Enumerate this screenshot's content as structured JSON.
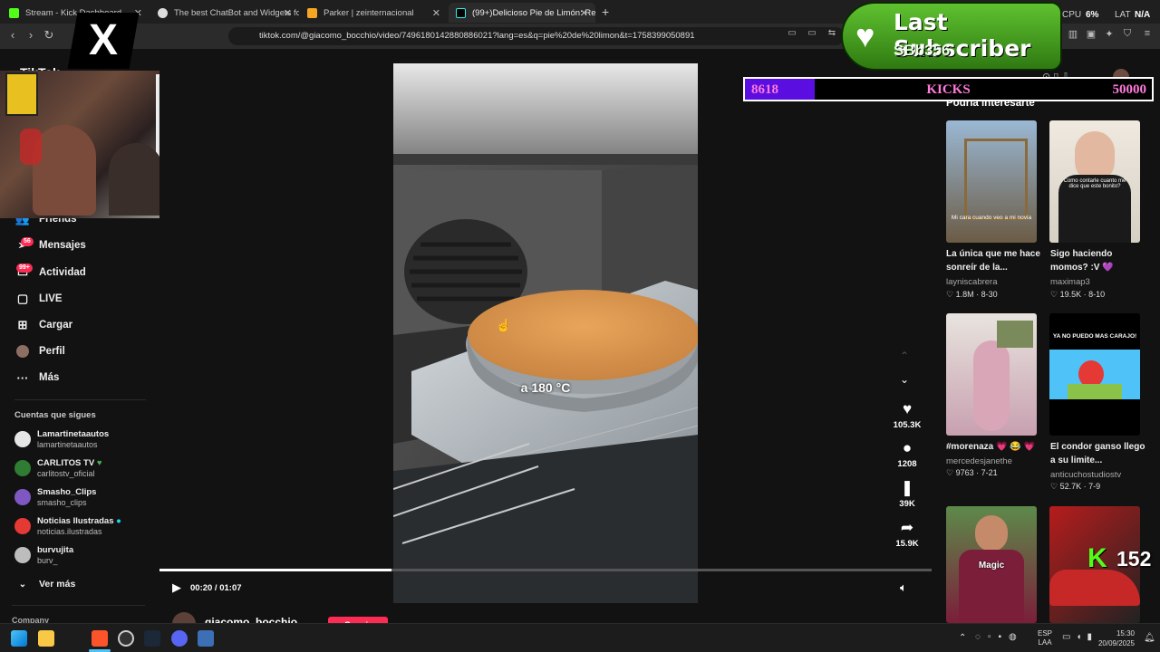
{
  "browser": {
    "tabs": [
      {
        "title": "Stream - Kick Dashboard",
        "active": false
      },
      {
        "title": "The best ChatBot and Widgets for Ki",
        "active": false
      },
      {
        "title": "Parker | zeinternacional",
        "active": false
      },
      {
        "title": "(99+)Delicioso Pie de Limón: Re",
        "active": true
      }
    ],
    "new_tab_label": "+",
    "url": "tiktok.com/@giacomo_bocchio/video/7496180142880886021?lang=es&q=pie%20de%20limon&t=1758399050891",
    "cpu_label": "CPU",
    "cpu_value": "6%",
    "lat_label": "LAT",
    "lat_value": "N/A"
  },
  "overlay": {
    "x_logo": "X",
    "subscriber_title": "Last Subscriber",
    "subscriber_name": "SBb356",
    "kicks_current": "8618",
    "kicks_label": "KICKS",
    "kicks_goal": "50000",
    "kicks_progress": 0.172,
    "kick_logo": "K",
    "kick_count": "152"
  },
  "sidebar": {
    "logo_partial": "TikTok",
    "nav": [
      {
        "label": "Friends",
        "icon": "friends-icon"
      },
      {
        "label": "Mensajes",
        "icon": "messages-icon",
        "badge": "56"
      },
      {
        "label": "Actividad",
        "icon": "activity-icon",
        "badge": "99+"
      },
      {
        "label": "LIVE",
        "icon": "live-icon"
      },
      {
        "label": "Cargar",
        "icon": "upload-icon"
      },
      {
        "label": "Perfil",
        "icon": "profile-icon"
      },
      {
        "label": "Más",
        "icon": "more-icon"
      }
    ],
    "following_heading": "Cuentas que sigues",
    "following": [
      {
        "name": "Lamartinetaautos",
        "handle": "lamartinetaautos",
        "color": "#e6e6e6"
      },
      {
        "name": "CARLITOS TV",
        "handle": "carlitostv_oficial",
        "color": "#2e7d32"
      },
      {
        "name": "Smasho_Clips",
        "handle": "smasho_clips",
        "color": "#7e57c2"
      },
      {
        "name": "Noticias Ilustradas",
        "handle": "noticias.ilustradas",
        "color": "#e53935"
      },
      {
        "name": "burvujita",
        "handle": "burv_",
        "color": "#bdbdbd"
      }
    ],
    "see_more": "Ver más",
    "company": "Company"
  },
  "video": {
    "caption_overlay": "a 180 °C",
    "time": "00:20 / 01:07",
    "progress": 0.3,
    "author": "giacomo_bocchio",
    "follow_label": "Seguir"
  },
  "actions": [
    {
      "icon": "heart-icon",
      "count": "105.3K"
    },
    {
      "icon": "comment-icon",
      "count": "1208"
    },
    {
      "icon": "bookmark-icon",
      "count": "39K"
    },
    {
      "icon": "share-icon",
      "count": "15.9K"
    }
  ],
  "recommendations": {
    "heading": "Podría interesarte",
    "items": [
      {
        "title": "La única que me hace sonreír de la...",
        "user": "layniscabrera",
        "likes": "1.8M",
        "date": "8-30",
        "thumb_text": "Mi cara cuando veo a mi novia",
        "c1": "#8aa8c8",
        "c2": "#6b5b45"
      },
      {
        "title": "Sigo haciendo momos? :V 💜",
        "user": "maximap3",
        "likes": "19.5K",
        "date": "8-10",
        "thumb_text": "Como contarle cuanto me dice que este bonito?",
        "c1": "#e8e2d8",
        "c2": "#1a1a1a"
      },
      {
        "title": "#morenaza 💗 😂 💗",
        "user": "mercedesjanethe",
        "likes": "9763",
        "date": "7-21",
        "thumb_text": "",
        "c1": "#e8e4de",
        "c2": "#d9a6b8"
      },
      {
        "title": "El condor ganso llego a su limite...",
        "user": "anticuchostudiostv",
        "likes": "52.7K",
        "date": "7-9",
        "thumb_text": "YA NO PUEDO MAS CARAJO!",
        "c1": "#000000",
        "c2": "#4fc3f7"
      },
      {
        "title": "",
        "user": "",
        "likes": "",
        "date": "",
        "thumb_text": "Magic",
        "c1": "#5d8a4a",
        "c2": "#7b1e3a"
      },
      {
        "title": "",
        "user": "",
        "likes": "",
        "date": "",
        "thumb_text": "",
        "c1": "#b71c1c",
        "c2": "#222222"
      }
    ]
  },
  "taskbar": {
    "lang": "ESP",
    "lang2": "LAA",
    "time": "15:30",
    "date": "20/09/2025"
  }
}
